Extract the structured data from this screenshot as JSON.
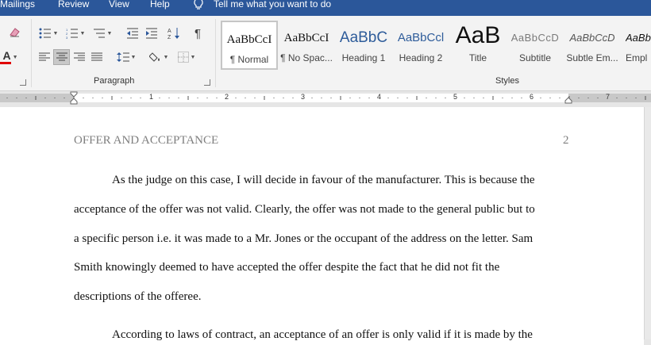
{
  "tabs": {
    "mailings": "Mailings",
    "review": "Review",
    "view": "View",
    "help": "Help",
    "tell_me": "Tell me what you want to do"
  },
  "ribbon": {
    "paragraph_label": "Paragraph",
    "styles_label": "Styles",
    "pilcrow": "¶",
    "styles": [
      {
        "preview": "AaBbCcI",
        "name": "¶ Normal",
        "selected": true
      },
      {
        "preview": "AaBbCcI",
        "name": "¶ No Spac..."
      },
      {
        "preview": "AaBbC",
        "name": "Heading 1"
      },
      {
        "preview": "AaBbCcl",
        "name": "Heading 2"
      },
      {
        "preview": "AaB",
        "name": "Title"
      },
      {
        "preview": "AaBbCcD",
        "name": "Subtitle"
      },
      {
        "preview": "AaBbCcD",
        "name": "Subtle Em..."
      },
      {
        "preview": "AaBbC",
        "name": "Empl"
      }
    ],
    "accent_color": "#2b579a",
    "font_color_bar": "#e00000"
  },
  "ruler": {
    "numbers": [
      "1",
      "2",
      "3",
      "4",
      "5",
      "6",
      "7"
    ]
  },
  "document": {
    "header": "OFFER AND ACCEPTANCE",
    "page_number": "2",
    "lines": [
      "As the judge on this case, I will decide in favour of the manufacturer. This is because the",
      "acceptance of the offer was not valid. Clearly, the offer was not made to the general public but to",
      "a specific person i.e. it was made to a Mr. Jones or the occupant of the address on the letter. Sam",
      "Smith knowingly deemed to have accepted the offer despite the fact that he did not fit the",
      "descriptions of the offeree.",
      "According to laws of contract, an acceptance of an offer is only valid if it is made by the"
    ]
  }
}
